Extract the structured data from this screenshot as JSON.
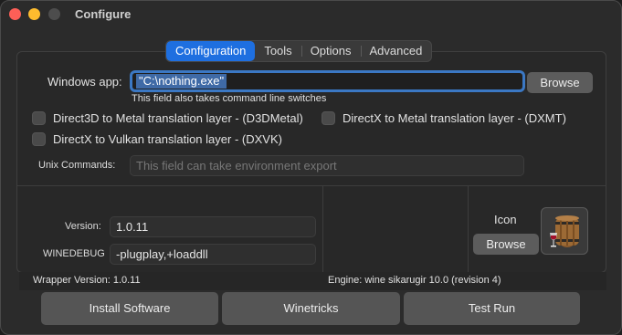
{
  "window": {
    "title": "Configure"
  },
  "tabs": [
    {
      "label": "Configuration",
      "active": true
    },
    {
      "label": "Tools",
      "active": false
    },
    {
      "label": "Options",
      "active": false
    },
    {
      "label": "Advanced",
      "active": false
    }
  ],
  "app": {
    "label": "Windows app:",
    "value": "\"C:\\nothing.exe\"",
    "hint": "This field also takes command line switches",
    "browse_label": "Browse"
  },
  "checkboxes": [
    {
      "label": "Direct3D to Metal translation layer - (D3DMetal)",
      "checked": false
    },
    {
      "label": "DirectX to Metal translation layer - (DXMT)",
      "checked": false
    },
    {
      "label": "DirectX to Vulkan translation layer - (DXVK)",
      "checked": false
    }
  ],
  "unix": {
    "label": "Unix Commands:",
    "placeholder": "This field can take environment export"
  },
  "version": {
    "label": "Version:",
    "value": "1.0.11"
  },
  "winedebug": {
    "label": "WINEDEBUG",
    "value": "-plugplay,+loaddll"
  },
  "icon": {
    "label": "Icon",
    "browse_label": "Browse",
    "icon_name": "wine-barrel-icon"
  },
  "status": {
    "wrapper": "Wrapper Version:  1.0.11",
    "engine": "Engine: wine sikarugir 10.0 (revision 4)"
  },
  "buttons": {
    "install": "Install Software",
    "winetricks": "Winetricks",
    "test_run": "Test Run"
  },
  "colors": {
    "accent": "#1e6fe0",
    "focus_ring": "#3b78c4",
    "close": "#fe5f57",
    "minimize": "#febc2e"
  }
}
